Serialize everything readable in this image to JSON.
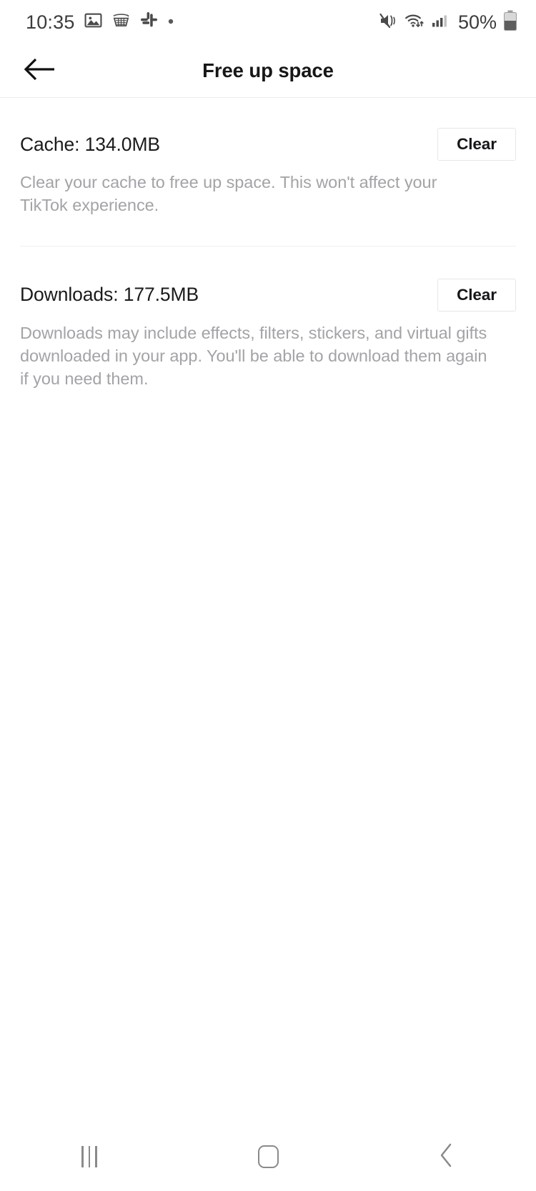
{
  "status_bar": {
    "clock": "10:35",
    "battery_percent": "50%",
    "left_icons": [
      "gallery-icon",
      "amazon-cart-icon",
      "slack-icon",
      "dot-indicator-icon"
    ],
    "right_icons": [
      "mute-vibrate-icon",
      "wifi-icon",
      "cellular-signal-icon",
      "battery-icon"
    ],
    "text_color": "#3c3c3c"
  },
  "header": {
    "title": "Free up space",
    "back_icon": "arrow-left-icon"
  },
  "sections": {
    "cache": {
      "title": "Cache: 134.0MB",
      "description": "Clear your cache to free up space. This won't affect your TikTok experience.",
      "button_label": "Clear"
    },
    "downloads": {
      "title": "Downloads: 177.5MB",
      "description": "Downloads may include effects, filters, stickers, and virtual gifts downloaded in your app. You'll be able to download them again if you need them.",
      "button_label": "Clear"
    }
  },
  "nav_bar": {
    "recents": "recents-icon",
    "home": "home-icon",
    "back": "back-chevron-icon"
  },
  "colors": {
    "background": "#ffffff",
    "title_text": "#17171a",
    "body_text": "#1b1b1e",
    "muted_text": "#a3a3a8",
    "divider": "#efefef",
    "button_border": "#e7e7e8",
    "nav_icon": "#8a8a8e"
  }
}
